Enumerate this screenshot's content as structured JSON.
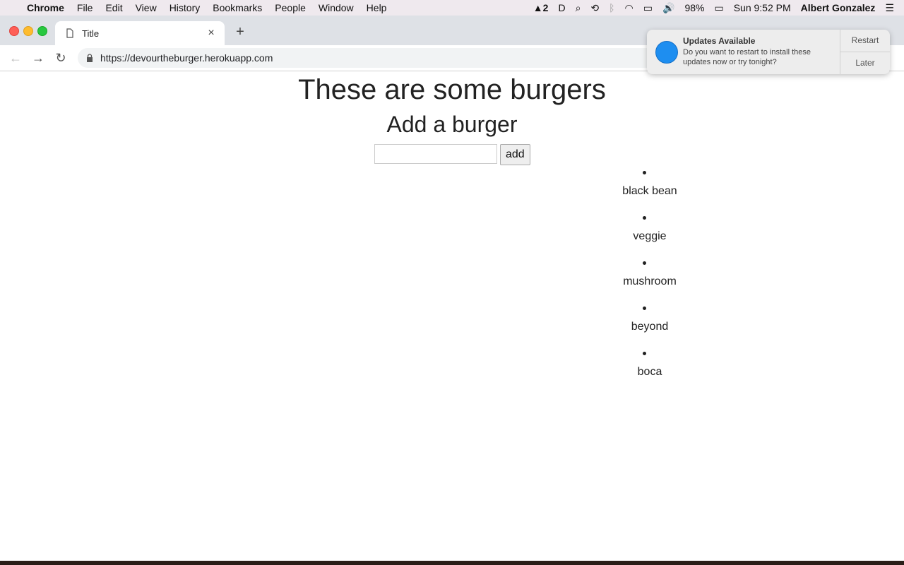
{
  "menubar": {
    "app": "Chrome",
    "items": [
      "File",
      "Edit",
      "View",
      "History",
      "Bookmarks",
      "People",
      "Window",
      "Help"
    ],
    "status_badge": "2",
    "battery": "98%",
    "clock": "Sun 9:52 PM",
    "user": "Albert Gonzalez"
  },
  "browser": {
    "tab_title": "Title",
    "url": "https://devourtheburger.herokuapp.com"
  },
  "page": {
    "heading": "These are some burgers",
    "subheading": "Add a burger",
    "input_value": "",
    "add_label": "add",
    "burgers": [
      "black bean",
      "veggie",
      "mushroom",
      "beyond",
      "boca"
    ]
  },
  "notification": {
    "title": "Updates Available",
    "body": "Do you want to restart to install these updates now or try tonight?",
    "restart_label": "Restart",
    "later_label": "Later"
  }
}
